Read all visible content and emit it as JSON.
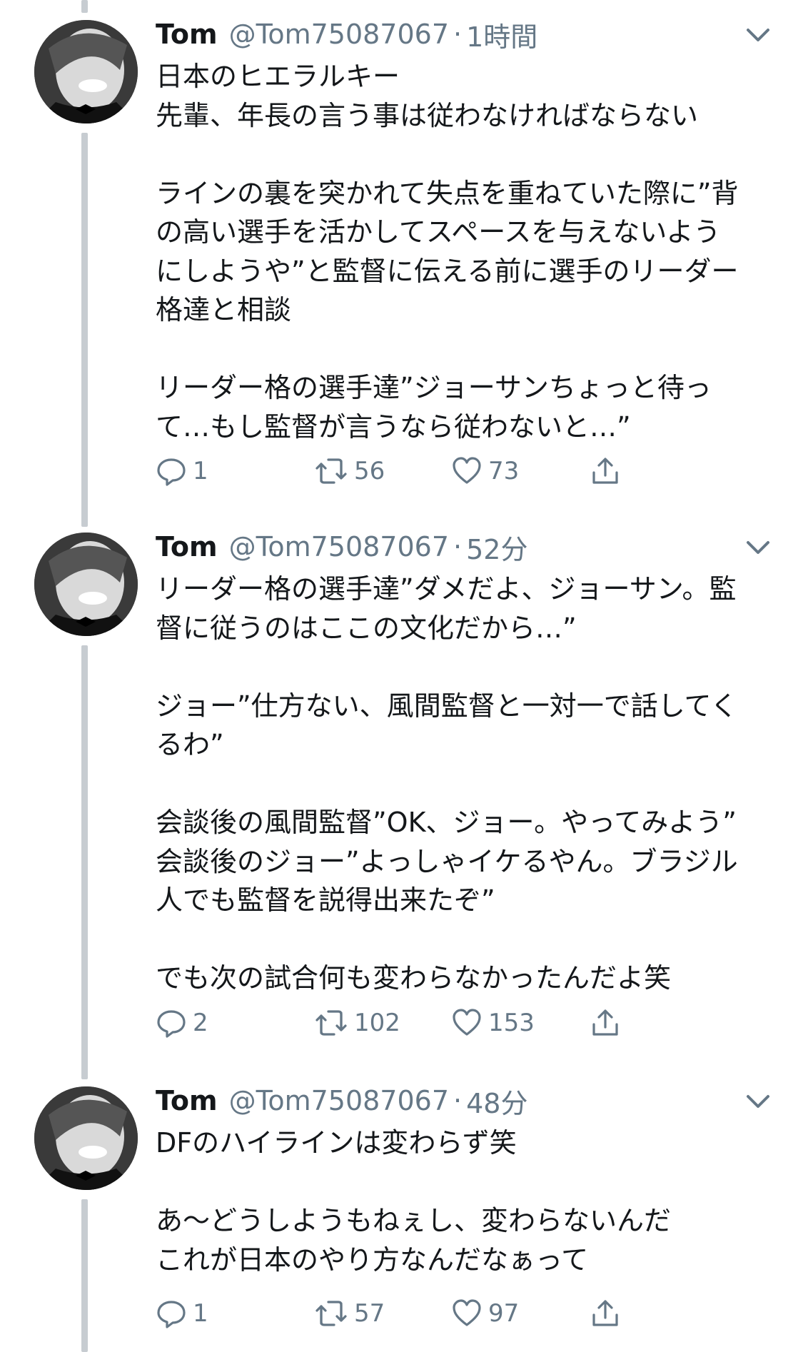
{
  "tweets": [
    {
      "name": "Tom",
      "handle": "@Tom75087067",
      "sep": "·",
      "time": "1時間",
      "lines": [
        "日本のヒエラルキー",
        "先輩、年長の言う事は従わなければならない",
        "",
        "ラインの裏を突かれて失点を重ねていた際に”背",
        "の高い選手を活かしてスペースを与えないよう",
        "にしようや”と監督に伝える前に選手のリーダー",
        "格達と相談",
        "",
        "リーダー格の選手達”ジョーサンちょっと待っ",
        "て…もし監督が言うなら従わないと…”"
      ],
      "reply_count": "1",
      "retweet_count": "56",
      "like_count": "73"
    },
    {
      "name": "Tom",
      "handle": "@Tom75087067",
      "sep": "·",
      "time": "52分",
      "lines": [
        "リーダー格の選手達”ダメだよ、ジョーサン。監",
        "督に従うのはここの文化だから…”",
        "",
        "ジョー”仕方ない、風間監督と一対一で話してく",
        "るわ”",
        "",
        "会談後の風間監督”OK、ジョー。やってみよう”",
        "会談後のジョー”よっしゃイケるやん。ブラジル",
        "人でも監督を説得出来たぞ”",
        "",
        "でも次の試合何も変わらなかったんだよ笑"
      ],
      "reply_count": "2",
      "retweet_count": "102",
      "like_count": "153"
    },
    {
      "name": "Tom",
      "handle": "@Tom75087067",
      "sep": "·",
      "time": "48分",
      "lines": [
        "DFのハイラインは変わらず笑",
        "",
        "あ〜どうしようもねぇし、変わらないんだ",
        "これが日本のやり方なんだなぁって"
      ],
      "reply_count": "1",
      "retweet_count": "57",
      "like_count": "97"
    }
  ],
  "icons": {
    "reply": "reply-icon",
    "retweet": "retweet-icon",
    "like": "heart-icon",
    "share": "share-icon",
    "more": "chevron-down-icon"
  },
  "colors": {
    "text": "#14171a",
    "muted": "#657786",
    "thread_line": "#c7ccd1"
  }
}
